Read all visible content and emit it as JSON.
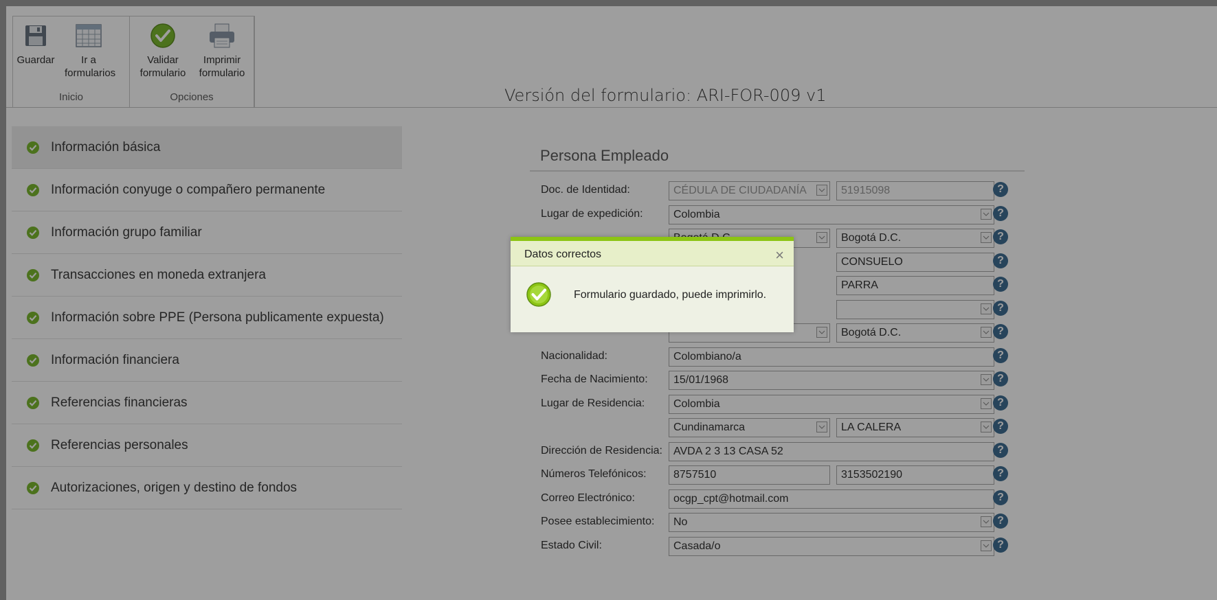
{
  "ribbon": {
    "groups": [
      {
        "label": "Inicio",
        "buttons": [
          {
            "label": "Guardar"
          },
          {
            "label": "Ir a formularios"
          }
        ]
      },
      {
        "label": "Opciones",
        "buttons": [
          {
            "label": "Validar formulario"
          },
          {
            "label": "Imprimir formulario"
          }
        ]
      }
    ]
  },
  "version": "Versión del formulario: ARI-FOR-009 v1",
  "sidenav": {
    "items": [
      {
        "label": "Información básica"
      },
      {
        "label": "Información conyuge o compañero permanente"
      },
      {
        "label": "Información grupo familiar"
      },
      {
        "label": "Transacciones en moneda extranjera"
      },
      {
        "label": "Información sobre PPE (Persona publicamente expuesta)"
      },
      {
        "label": "Información financiera"
      },
      {
        "label": "Referencias financieras"
      },
      {
        "label": "Referencias personales"
      },
      {
        "label": "Autorizaciones, origen y destino de fondos"
      }
    ]
  },
  "form": {
    "title": "Persona Empleado",
    "doc_label": "Doc. de Identidad:",
    "doc_type": "CÉDULA DE CIUDADANÍA",
    "doc_number": "51915098",
    "exp_label": "Lugar de expedición:",
    "exp_country": "Colombia",
    "exp_dept": "Bogotá D.C.",
    "exp_city": "Bogotá D.C.",
    "name2": "CONSUELO",
    "surname2": "PARRA",
    "birth_city": "Bogotá D.C.",
    "nat_label": "Nacionalidad:",
    "nat_value": "Colombiano/a",
    "dob_label": "Fecha de Nacimiento:",
    "dob_value": "15/01/1968",
    "res_label": "Lugar de Residencia:",
    "res_country": "Colombia",
    "res_dept": "Cundinamarca",
    "res_city": "LA CALERA",
    "addr_label": "Dirección de Residencia:",
    "addr_value": "AVDA 2 3 13 CASA 52",
    "phone_label": "Números Telefónicos:",
    "phone1": "8757510",
    "phone2": "3153502190",
    "email_label": "Correo Electrónico:",
    "email_value": "ocgp_cpt@hotmail.com",
    "estab_label": "Posee establecimiento:",
    "estab_value": "No",
    "civil_label": "Estado Civil:",
    "civil_value": "Casada/o",
    "help_glyph": "?"
  },
  "dialog": {
    "title": "Datos correctos",
    "close": "×",
    "message": "Formulario guardado, puede imprimirlo."
  },
  "colors": {
    "accent_green": "#8cc414",
    "help_blue": "#3f6e93",
    "check_green": "#7bb830"
  },
  "icons": [
    "save-icon",
    "grid-icon",
    "check-circle-icon",
    "printer-icon",
    "help-icon",
    "close-icon",
    "chevron-down-icon"
  ]
}
